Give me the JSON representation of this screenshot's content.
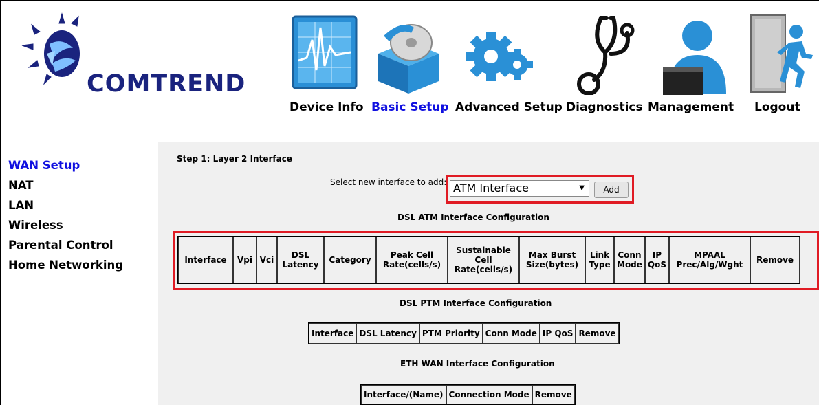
{
  "brand": {
    "name": "COMTREND"
  },
  "nav": [
    {
      "label": "Device Info",
      "icon": "chart-monitor-icon",
      "active": false
    },
    {
      "label": "Basic Setup",
      "icon": "disc-box-icon",
      "active": true
    },
    {
      "label": "Advanced Setup",
      "icon": "gears-icon",
      "active": false
    },
    {
      "label": "Diagnostics",
      "icon": "stethoscope-icon",
      "active": false
    },
    {
      "label": "Management",
      "icon": "user-laptop-icon",
      "active": false
    },
    {
      "label": "Logout",
      "icon": "exit-door-icon",
      "active": false
    }
  ],
  "sidebar": {
    "items": [
      {
        "label": "WAN Setup",
        "active": true
      },
      {
        "label": "NAT"
      },
      {
        "label": "LAN"
      },
      {
        "label": "Wireless"
      },
      {
        "label": "Parental Control"
      },
      {
        "label": "Home Networking"
      }
    ]
  },
  "main": {
    "step_title": "Step 1: Layer 2 Interface",
    "select_label": "Select new interface to add:",
    "select_value": "ATM Interface",
    "add_label": "Add",
    "atm_title": "DSL ATM Interface Configuration",
    "atm_headers": [
      "Interface",
      "Vpi",
      "Vci",
      "DSL Latency",
      "Category",
      "Peak Cell Rate(cells/s)",
      "Sustainable Cell Rate(cells/s)",
      "Max Burst Size(bytes)",
      "Link Type",
      "Conn Mode",
      "IP QoS",
      "MPAAL Prec/Alg/Wght",
      "Remove"
    ],
    "ptm_title": "DSL PTM Interface Configuration",
    "ptm_headers": [
      "Interface",
      "DSL Latency",
      "PTM Priority",
      "Conn Mode",
      "IP QoS",
      "Remove"
    ],
    "eth_title": "ETH WAN Interface Configuration",
    "eth_headers": [
      "Interface/(Name)",
      "Connection Mode",
      "Remove"
    ]
  },
  "colors": {
    "highlight": "#e01b24",
    "active_link": "#1010e0",
    "panel_bg": "#f0f0f0"
  }
}
